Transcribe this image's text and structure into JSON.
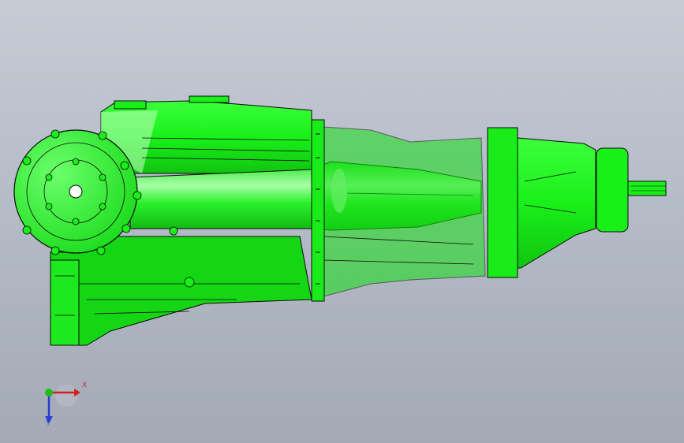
{
  "viewport": {
    "background_top": "#c6ccd6",
    "background_bottom": "#a3aab5"
  },
  "model": {
    "color_main": "#19f019",
    "color_shadow": "#0fb40f",
    "color_highlight": "#b8ffb8",
    "edge_color": "#0a0a0a"
  },
  "triad": {
    "x_label": "X",
    "y_label": "Y",
    "x_color": "#d42020",
    "y_color": "#2a3bd6",
    "z_color": "#18c018"
  }
}
